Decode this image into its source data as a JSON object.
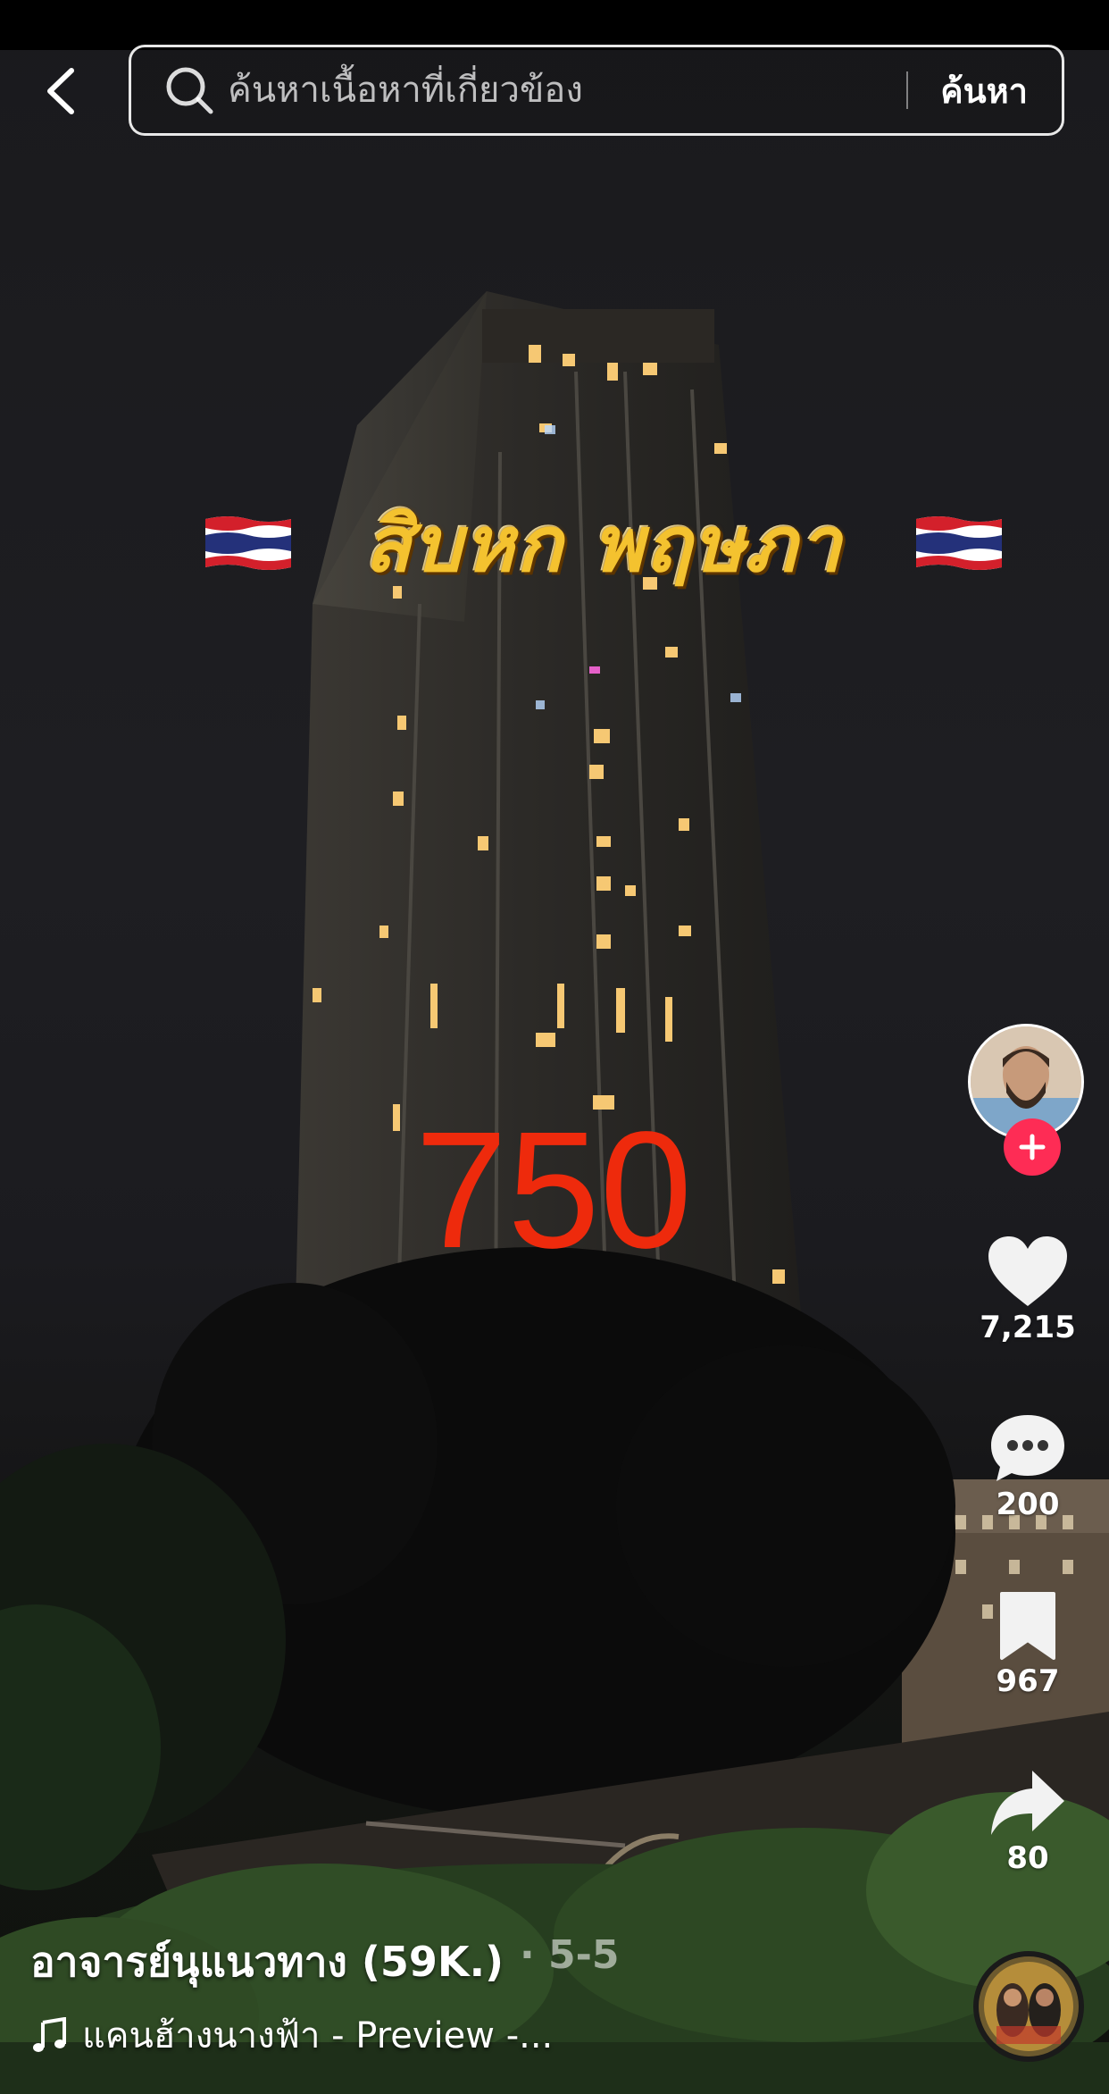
{
  "search": {
    "placeholder": "ค้นหาเนื้อหาที่เกี่ยวข้อง",
    "submit_label": "ค้นหา"
  },
  "overlay": {
    "title": "สิบหก พฤษภา",
    "number": "750"
  },
  "actions": {
    "likes": "7,215",
    "comments": "200",
    "saves": "967",
    "shares": "80"
  },
  "post": {
    "author": "อาจารย์นุแนวทาง (59K.)",
    "date": "· 5-5",
    "music": "แคนฮ้างนางฟ้า - Preview -..."
  },
  "colors": {
    "accent": "#fe2c55",
    "title_gold": "#f4c22f",
    "number_red": "#ee2a0c"
  },
  "icons": [
    "back-icon",
    "search-icon",
    "plus-icon",
    "heart-icon",
    "comment-icon",
    "bookmark-icon",
    "share-icon",
    "music-note-icon",
    "flag-icon"
  ]
}
